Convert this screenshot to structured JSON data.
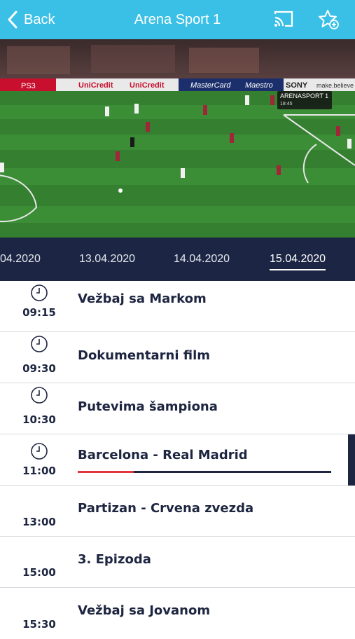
{
  "header": {
    "back_label": "Back",
    "title": "Arena Sport 1",
    "cast_icon": "cast-icon",
    "favorite_icon": "star-add-icon",
    "background": "#3ac0e6"
  },
  "video": {
    "channel_logo": "ARENASPORT 1",
    "logo_time": "18:45",
    "ad_boards": [
      "PS3",
      "UniCredit",
      "UniCredit",
      "MasterCard",
      "Maestro",
      "SONY",
      "make.believe"
    ]
  },
  "dates": {
    "items": [
      "04.2020",
      "13.04.2020",
      "14.04.2020",
      "15.04.2020"
    ],
    "selected": "15.04.2020",
    "background": "#1c2644"
  },
  "schedule": [
    {
      "time": "09:15",
      "title": "Vežbaj sa Markom",
      "has_clock": true
    },
    {
      "time": "09:30",
      "title": "Dokumentarni film",
      "has_clock": true
    },
    {
      "time": "10:30",
      "title": "Putevima šampiona",
      "has_clock": true
    },
    {
      "time": "11:00",
      "title": "Barcelona - Real Madrid",
      "has_clock": true,
      "live": true,
      "progress": 0.22
    },
    {
      "time": "13:00",
      "title": "Partizan - Crvena zvezda",
      "has_clock": false
    },
    {
      "time": "15:00",
      "title": "3. Epizoda",
      "has_clock": false
    },
    {
      "time": "15:30",
      "title": "Vežbaj sa Jovanom",
      "has_clock": false
    }
  ],
  "colors": {
    "accent_red": "#e1353f",
    "text_dark": "#1d2540"
  }
}
